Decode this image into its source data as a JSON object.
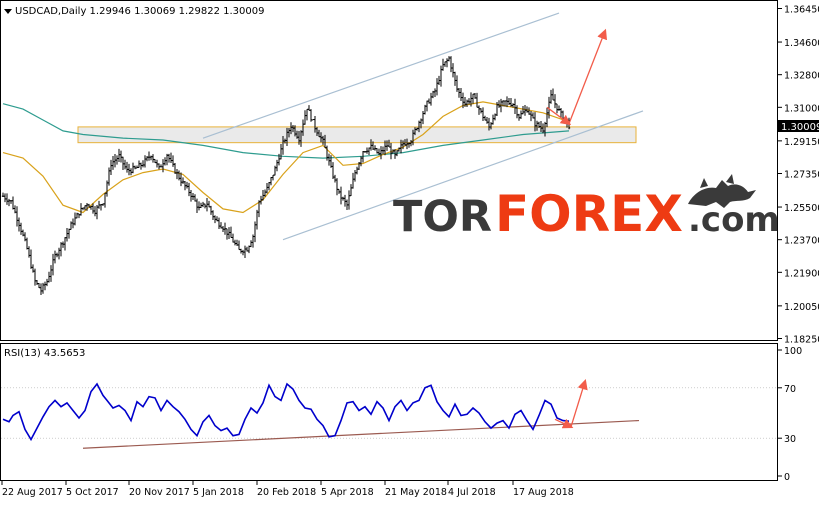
{
  "header": {
    "symbol_info": "USDCAD,Daily  1.29946 1.30069 1.29822 1.30009"
  },
  "rsi_panel": {
    "label": "RSI(13) 43.5653",
    "levels": [
      "100",
      "70",
      "30",
      "0"
    ]
  },
  "watermark": {
    "part1": "TOR",
    "part2": "FOREX",
    "part3": ".com"
  },
  "colors": {
    "candles": "#000000",
    "ma_fast": "#d9a21b",
    "ma_slow": "#2e9c8f",
    "channel": "#a9bfd2",
    "zone_fill": "#e3e3e3",
    "zone_border": "#e8b23a",
    "arrow": "#f25c4a",
    "rsi_line": "#0000cc",
    "rsi_trend": "#9b5a50",
    "brand_grey": "#3a3a3a",
    "brand_orange": "#ee3b13",
    "price_tag_bg": "#000000"
  },
  "chart_data": {
    "type": "candlestick",
    "symbol": "USDCAD",
    "timeframe": "Daily",
    "last_bar": {
      "open": 1.29946,
      "high": 1.30069,
      "low": 1.29822,
      "close": 1.30009
    },
    "current_price": "1.30009",
    "price_axis_labels": [
      "1.36450",
      "1.34600",
      "1.32800",
      "1.31000",
      "1.29150",
      "1.27350",
      "1.25500",
      "1.23700",
      "1.21900",
      "1.20050",
      "1.18250"
    ],
    "date_axis_labels": [
      "22 Aug 2017",
      "5 Oct 2017",
      "20 Nov 2017",
      "5 Jan 2018",
      "20 Feb 2018",
      "5 Apr 2018",
      "21 May 2018",
      "4 Jul 2018",
      "17 Aug 2018"
    ],
    "close_path": [
      [
        0,
        1.261
      ],
      [
        4,
        1.258
      ],
      [
        8,
        1.246
      ],
      [
        12,
        1.232
      ],
      [
        16,
        1.214
      ],
      [
        19,
        1.209
      ],
      [
        22,
        1.214
      ],
      [
        26,
        1.228
      ],
      [
        30,
        1.236
      ],
      [
        34,
        1.245
      ],
      [
        38,
        1.252
      ],
      [
        42,
        1.257
      ],
      [
        46,
        1.253
      ],
      [
        50,
        1.258
      ],
      [
        54,
        1.279
      ],
      [
        58,
        1.283
      ],
      [
        62,
        1.275
      ],
      [
        66,
        1.276
      ],
      [
        70,
        1.279
      ],
      [
        74,
        1.284
      ],
      [
        78,
        1.276
      ],
      [
        82,
        1.284
      ],
      [
        86,
        1.275
      ],
      [
        90,
        1.268
      ],
      [
        94,
        1.262
      ],
      [
        98,
        1.254
      ],
      [
        102,
        1.257
      ],
      [
        106,
        1.248
      ],
      [
        110,
        1.244
      ],
      [
        114,
        1.238
      ],
      [
        118,
        1.231
      ],
      [
        122,
        1.232
      ],
      [
        125,
        1.239
      ],
      [
        128,
        1.258
      ],
      [
        132,
        1.265
      ],
      [
        136,
        1.276
      ],
      [
        140,
        1.29
      ],
      [
        144,
        1.3
      ],
      [
        148,
        1.293
      ],
      [
        152,
        1.31
      ],
      [
        156,
        1.299
      ],
      [
        160,
        1.291
      ],
      [
        164,
        1.276
      ],
      [
        168,
        1.262
      ],
      [
        172,
        1.256
      ],
      [
        176,
        1.274
      ],
      [
        180,
        1.286
      ],
      [
        184,
        1.288
      ],
      [
        188,
        1.284
      ],
      [
        192,
        1.289
      ],
      [
        196,
        1.283
      ],
      [
        200,
        1.29
      ],
      [
        204,
        1.292
      ],
      [
        208,
        1.302
      ],
      [
        212,
        1.312
      ],
      [
        216,
        1.319
      ],
      [
        220,
        1.333
      ],
      [
        223,
        1.337
      ],
      [
        227,
        1.32
      ],
      [
        231,
        1.312
      ],
      [
        235,
        1.316
      ],
      [
        239,
        1.307
      ],
      [
        243,
        1.299
      ],
      [
        247,
        1.31
      ],
      [
        251,
        1.313
      ],
      [
        255,
        1.312
      ],
      [
        258,
        1.305
      ],
      [
        262,
        1.309
      ],
      [
        266,
        1.301
      ],
      [
        270,
        1.298
      ],
      [
        274,
        1.316
      ],
      [
        277,
        1.31
      ],
      [
        280,
        1.304
      ],
      [
        283,
        1.3
      ]
    ],
    "ma_fast": [
      [
        0,
        1.285
      ],
      [
        10,
        1.282
      ],
      [
        20,
        1.272
      ],
      [
        30,
        1.256
      ],
      [
        40,
        1.252
      ],
      [
        50,
        1.262
      ],
      [
        60,
        1.27
      ],
      [
        70,
        1.274
      ],
      [
        80,
        1.276
      ],
      [
        90,
        1.273
      ],
      [
        100,
        1.263
      ],
      [
        110,
        1.254
      ],
      [
        120,
        1.252
      ],
      [
        130,
        1.259
      ],
      [
        140,
        1.273
      ],
      [
        150,
        1.285
      ],
      [
        160,
        1.289
      ],
      [
        170,
        1.278
      ],
      [
        180,
        1.279
      ],
      [
        190,
        1.284
      ],
      [
        200,
        1.288
      ],
      [
        210,
        1.295
      ],
      [
        220,
        1.305
      ],
      [
        230,
        1.311
      ],
      [
        240,
        1.313
      ],
      [
        250,
        1.311
      ],
      [
        260,
        1.309
      ],
      [
        270,
        1.307
      ],
      [
        283,
        1.302
      ]
    ],
    "ma_slow": [
      [
        0,
        1.312
      ],
      [
        10,
        1.309
      ],
      [
        20,
        1.303
      ],
      [
        30,
        1.297
      ],
      [
        40,
        1.295
      ],
      [
        60,
        1.293
      ],
      [
        80,
        1.292
      ],
      [
        100,
        1.289
      ],
      [
        120,
        1.285
      ],
      [
        140,
        1.283
      ],
      [
        160,
        1.282
      ],
      [
        180,
        1.283
      ],
      [
        200,
        1.285
      ],
      [
        220,
        1.289
      ],
      [
        240,
        1.292
      ],
      [
        260,
        1.295
      ],
      [
        283,
        1.297
      ]
    ],
    "channel_upper": [
      [
        100,
        1.293
      ],
      [
        278,
        1.362
      ]
    ],
    "channel_lower": [
      [
        140,
        1.237
      ],
      [
        320,
        1.308
      ]
    ],
    "resistance_zone": {
      "from": 1.2905,
      "to": 1.2992
    },
    "forecast_arrows": [
      {
        "from": [
          272,
          1.31
        ],
        "to": [
          283,
          1.301
        ]
      },
      {
        "from": [
          283,
          1.301
        ],
        "to": [
          301,
          1.352
        ]
      }
    ],
    "rsi": {
      "period": 13,
      "value": 43.5653,
      "levels": [
        70,
        30
      ],
      "ylim": [
        0,
        100
      ],
      "series": [
        [
          0,
          45
        ],
        [
          3,
          43
        ],
        [
          5,
          48
        ],
        [
          8,
          51
        ],
        [
          11,
          37
        ],
        [
          14,
          29
        ],
        [
          17,
          38
        ],
        [
          20,
          47
        ],
        [
          23,
          55
        ],
        [
          26,
          60
        ],
        [
          29,
          55
        ],
        [
          32,
          58
        ],
        [
          35,
          52
        ],
        [
          38,
          46
        ],
        [
          41,
          52
        ],
        [
          44,
          67
        ],
        [
          47,
          73
        ],
        [
          50,
          64
        ],
        [
          52,
          60
        ],
        [
          55,
          54
        ],
        [
          58,
          56
        ],
        [
          61,
          52
        ],
        [
          64,
          44
        ],
        [
          67,
          59
        ],
        [
          70,
          55
        ],
        [
          73,
          63
        ],
        [
          76,
          62
        ],
        [
          79,
          52
        ],
        [
          82,
          60
        ],
        [
          85,
          55
        ],
        [
          88,
          51
        ],
        [
          91,
          45
        ],
        [
          94,
          37
        ],
        [
          97,
          32
        ],
        [
          100,
          43
        ],
        [
          103,
          48
        ],
        [
          106,
          40
        ],
        [
          109,
          36
        ],
        [
          112,
          38
        ],
        [
          115,
          32
        ],
        [
          118,
          33
        ],
        [
          121,
          45
        ],
        [
          124,
          54
        ],
        [
          127,
          50
        ],
        [
          130,
          58
        ],
        [
          133,
          72
        ],
        [
          136,
          63
        ],
        [
          139,
          60
        ],
        [
          142,
          73
        ],
        [
          145,
          69
        ],
        [
          148,
          60
        ],
        [
          151,
          54
        ],
        [
          154,
          53
        ],
        [
          157,
          45
        ],
        [
          160,
          40
        ],
        [
          163,
          31
        ],
        [
          166,
          32
        ],
        [
          169,
          44
        ],
        [
          172,
          58
        ],
        [
          175,
          59
        ],
        [
          178,
          52
        ],
        [
          181,
          55
        ],
        [
          184,
          49
        ],
        [
          187,
          59
        ],
        [
          190,
          54
        ],
        [
          193,
          44
        ],
        [
          196,
          55
        ],
        [
          199,
          60
        ],
        [
          202,
          52
        ],
        [
          205,
          58
        ],
        [
          208,
          60
        ],
        [
          211,
          70
        ],
        [
          214,
          72
        ],
        [
          217,
          59
        ],
        [
          220,
          52
        ],
        [
          223,
          47
        ],
        [
          226,
          57
        ],
        [
          229,
          48
        ],
        [
          232,
          49
        ],
        [
          235,
          54
        ],
        [
          238,
          50
        ],
        [
          241,
          43
        ],
        [
          244,
          38
        ],
        [
          247,
          42
        ],
        [
          250,
          44
        ],
        [
          253,
          38
        ],
        [
          256,
          49
        ],
        [
          259,
          52
        ],
        [
          262,
          44
        ],
        [
          265,
          37
        ],
        [
          268,
          48
        ],
        [
          271,
          60
        ],
        [
          274,
          57
        ],
        [
          277,
          46
        ],
        [
          280,
          44
        ],
        [
          283,
          43.5
        ]
      ],
      "trendline": [
        [
          40,
          22
        ],
        [
          318,
          44
        ]
      ],
      "forecast_arrows": [
        {
          "from": [
            276,
            45
          ],
          "to": [
            284,
            39
          ]
        },
        {
          "from": [
            284,
            39
          ],
          "to": [
            291,
            75
          ]
        }
      ]
    }
  }
}
